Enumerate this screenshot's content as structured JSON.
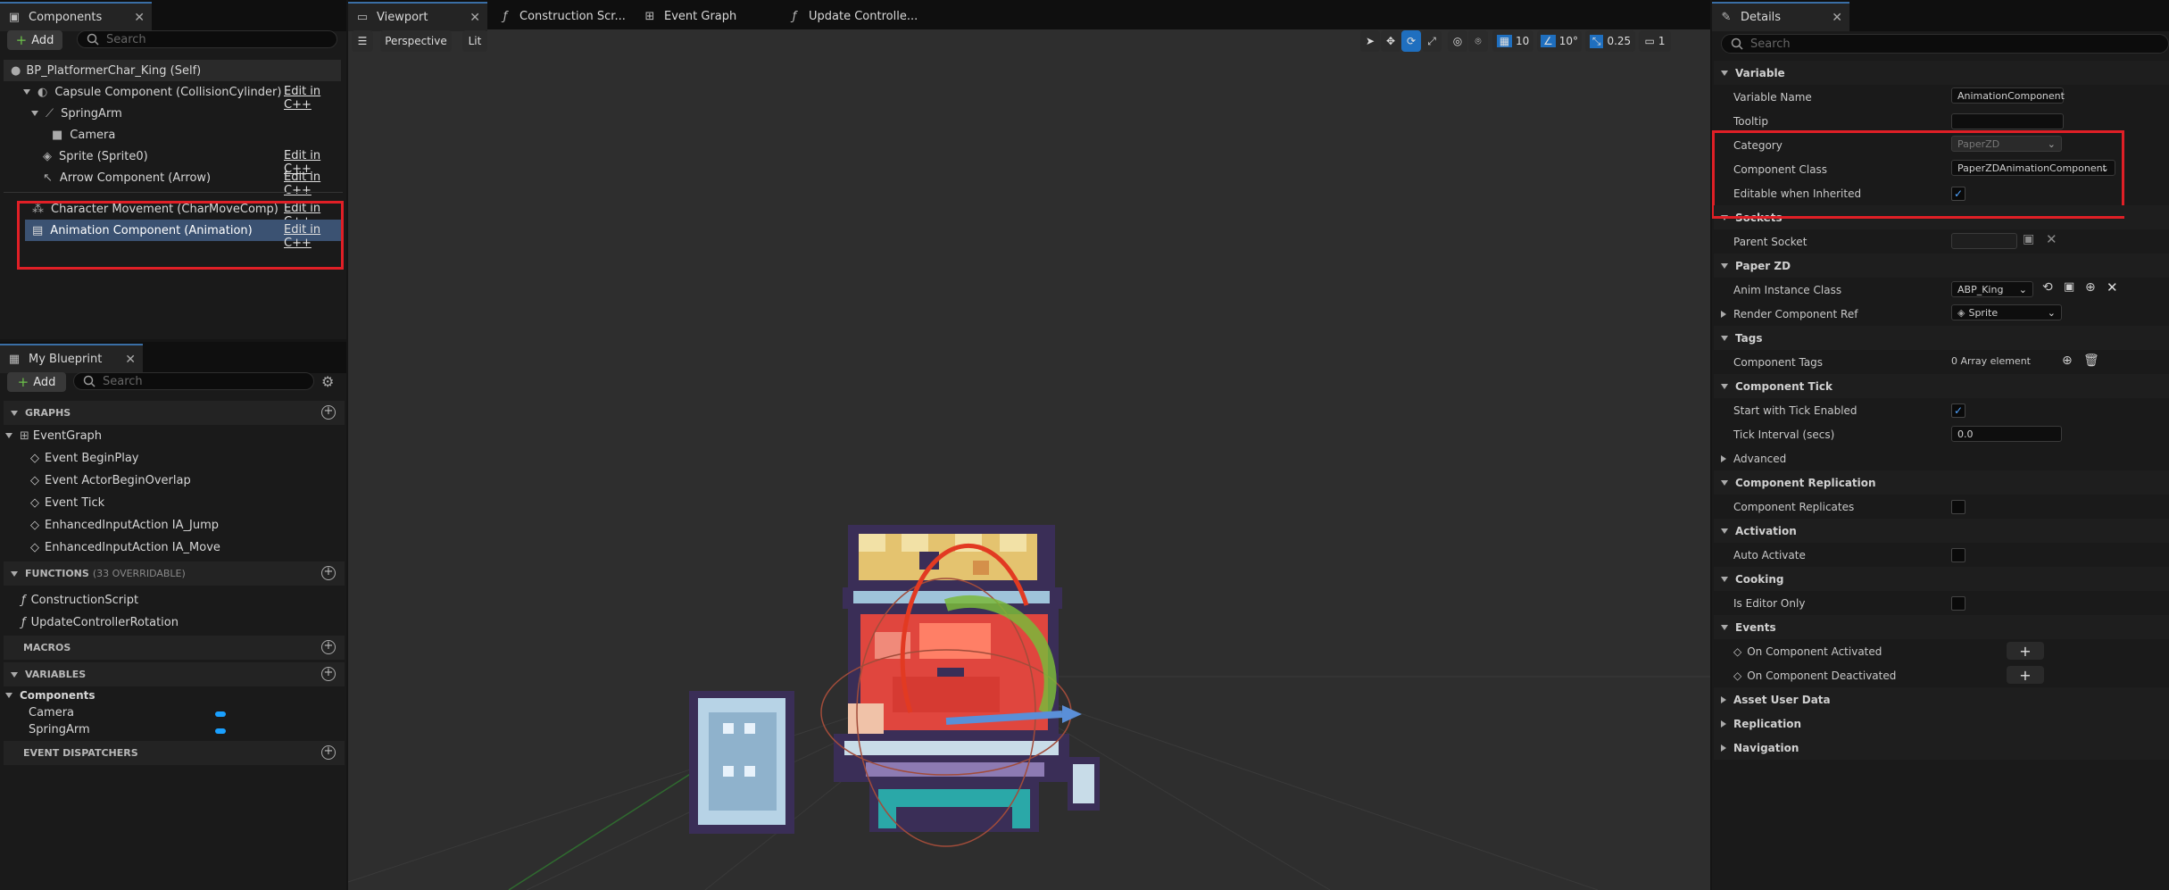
{
  "components_panel": {
    "tab_label": "Components",
    "add_label": "Add",
    "search_placeholder": "Search",
    "self_item": "BP_PlatformerChar_King (Self)",
    "items": [
      {
        "label": "Capsule Component (CollisionCylinder)",
        "edit": "Edit in C++"
      },
      {
        "label": "SpringArm",
        "edit": ""
      },
      {
        "label": "Camera",
        "edit": ""
      },
      {
        "label": "Sprite (Sprite0)",
        "edit": "Edit in C++"
      },
      {
        "label": "Arrow Component (Arrow)",
        "edit": "Edit in C++"
      },
      {
        "label": "Character Movement (CharMoveComp)",
        "edit": "Edit in C++"
      },
      {
        "label": "Animation Component (Animation)",
        "edit": "Edit in C++"
      }
    ]
  },
  "my_blueprint": {
    "tab_label": "My Blueprint",
    "add_label": "Add",
    "search_placeholder": "Search",
    "graphs_header": "GRAPHS",
    "event_graph": "EventGraph",
    "events": [
      "Event BeginPlay",
      "Event ActorBeginOverlap",
      "Event Tick",
      "EnhancedInputAction IA_Jump",
      "EnhancedInputAction IA_Move"
    ],
    "functions_header": "FUNCTIONS",
    "functions_overridable": "(33 OVERRIDABLE)",
    "functions": [
      "ConstructionScript",
      "UpdateControllerRotation"
    ],
    "macros_header": "MACROS",
    "variables_header": "VARIABLES",
    "components_category": "Components",
    "variables": [
      "Camera",
      "SpringArm"
    ],
    "dispatchers_header": "EVENT DISPATCHERS"
  },
  "editor_tabs": [
    "Viewport",
    "Construction Scr...",
    "Event Graph",
    "Update Controlle..."
  ],
  "viewport": {
    "perspective_label": "Perspective",
    "lit_label": "Lit",
    "grid_value": "10",
    "angle_value": "10°",
    "scale_value": "0.25",
    "camera_speed": "1"
  },
  "details": {
    "tab_label": "Details",
    "search_placeholder": "Search",
    "variable_header": "Variable",
    "variable_name_label": "Variable Name",
    "variable_name_value": "AnimationComponent",
    "tooltip_label": "Tooltip",
    "category_label": "Category",
    "category_value": "PaperZD",
    "component_class_label": "Component Class",
    "component_class_value": "PaperZDAnimationComponent",
    "editable_label": "Editable when Inherited",
    "sockets_header": "Sockets",
    "parent_socket_label": "Parent Socket",
    "paperzd_header": "Paper ZD",
    "anim_instance_label": "Anim Instance Class",
    "anim_instance_value": "ABP_King",
    "render_ref_label": "Render Component Ref",
    "render_ref_value": "Sprite",
    "tags_header": "Tags",
    "component_tags_label": "Component Tags",
    "component_tags_value": "0 Array element",
    "tick_header": "Component Tick",
    "start_tick_label": "Start with Tick Enabled",
    "tick_interval_label": "Tick Interval (secs)",
    "tick_interval_value": "0.0",
    "advanced_label": "Advanced",
    "replication_header": "Component Replication",
    "replicates_label": "Component Replicates",
    "activation_header": "Activation",
    "auto_activate_label": "Auto Activate",
    "cooking_header": "Cooking",
    "editor_only_label": "Is Editor Only",
    "events_header": "Events",
    "on_activated_label": "On Component Activated",
    "on_deactivated_label": "On Component Deactivated",
    "asset_user_data_label": "Asset User Data",
    "replication_label": "Replication",
    "navigation_label": "Navigation"
  },
  "colors": {
    "highlight_red": "#e01f26",
    "selection": "#3b5272",
    "accent_blue": "#1aa0ff"
  }
}
